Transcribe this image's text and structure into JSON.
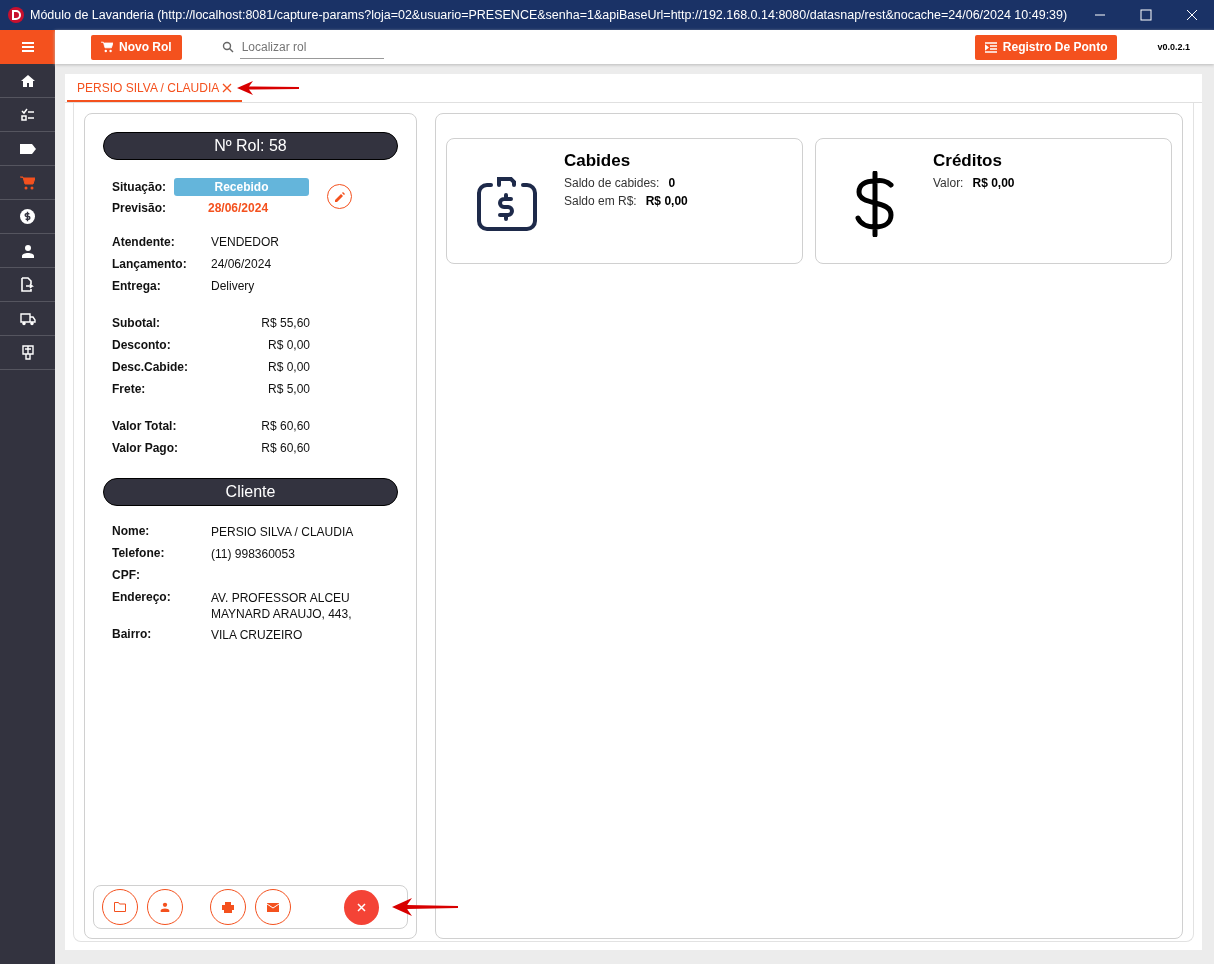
{
  "window": {
    "title": "Módulo de Lavanderia (http://localhost:8081/capture-params?loja=02&usuario=PRESENCE&senha=1&apiBaseUrl=http://192.168.0.14:8080/datasnap/rest&nocache=24/06/2024 10:49:39)"
  },
  "sidebar": {
    "items": [
      {
        "kind": "home",
        "selected": false
      },
      {
        "kind": "checklist",
        "selected": false
      },
      {
        "kind": "tag",
        "selected": false
      },
      {
        "kind": "cart",
        "selected": true
      },
      {
        "kind": "money",
        "selected": false
      },
      {
        "kind": "person",
        "selected": false
      },
      {
        "kind": "export",
        "selected": false
      },
      {
        "kind": "truck",
        "selected": false
      },
      {
        "kind": "hanger",
        "selected": false
      }
    ]
  },
  "toolbar": {
    "new_button": "Novo Rol",
    "search": {
      "placeholder": "Localizar rol"
    },
    "clock_button": "Registro De Ponto",
    "version": "v0.0.2.1"
  },
  "tabs": [
    {
      "label": "PERSIO SILVA / CLAUDIA",
      "selected": true
    }
  ],
  "order": {
    "header": "Nº Rol: 58",
    "status": {
      "label": "Situação:",
      "value": "Recebido"
    },
    "forecast": {
      "label": "Previsão:",
      "value": "28/06/2024"
    },
    "info": [
      {
        "label": "Atendente:",
        "value": "VENDEDOR"
      },
      {
        "label": "Lançamento:",
        "value": "24/06/2024"
      },
      {
        "label": "Entrega:",
        "value": "Delivery"
      }
    ],
    "amounts": [
      {
        "label": "Subotal:",
        "value": "R$ 55,60"
      },
      {
        "label": "Desconto:",
        "value": "R$ 0,00"
      },
      {
        "label": "Desc.Cabide:",
        "value": "R$ 0,00"
      },
      {
        "label": "Frete:",
        "value": "R$ 5,00"
      }
    ],
    "totals": [
      {
        "label": "Valor Total:",
        "value": "R$ 60,60"
      },
      {
        "label": "Valor Pago:",
        "value": "R$ 60,60"
      }
    ]
  },
  "client": {
    "header": "Cliente",
    "fields": [
      {
        "label": "Nome:",
        "value": "PERSIO SILVA / CLAUDIA"
      },
      {
        "label": "Telefone:",
        "value": "(11) 998360053"
      },
      {
        "label": "CPF:"
      },
      {
        "label": "Endereço:",
        "value": "AV. PROFESSOR ALCEU MAYNARD ARAUJO, 443,"
      },
      {
        "label": "Bairro:",
        "value": "VILA CRUZEIRO"
      }
    ]
  },
  "actions": [
    {
      "kind": "folder"
    },
    {
      "kind": "person"
    },
    {
      "kind": "print"
    },
    {
      "kind": "mail"
    }
  ],
  "cards": [
    {
      "kind": "hangers",
      "title": "Cabides",
      "lines": [
        {
          "label": "Saldo de cabides:",
          "value": "0"
        },
        {
          "label": "Saldo em R$:",
          "value": "R$ 0,00"
        }
      ]
    },
    {
      "kind": "credits",
      "title": "Créditos",
      "lines": [
        {
          "label": "Valor:",
          "value": "R$ 0,00"
        }
      ]
    }
  ]
}
